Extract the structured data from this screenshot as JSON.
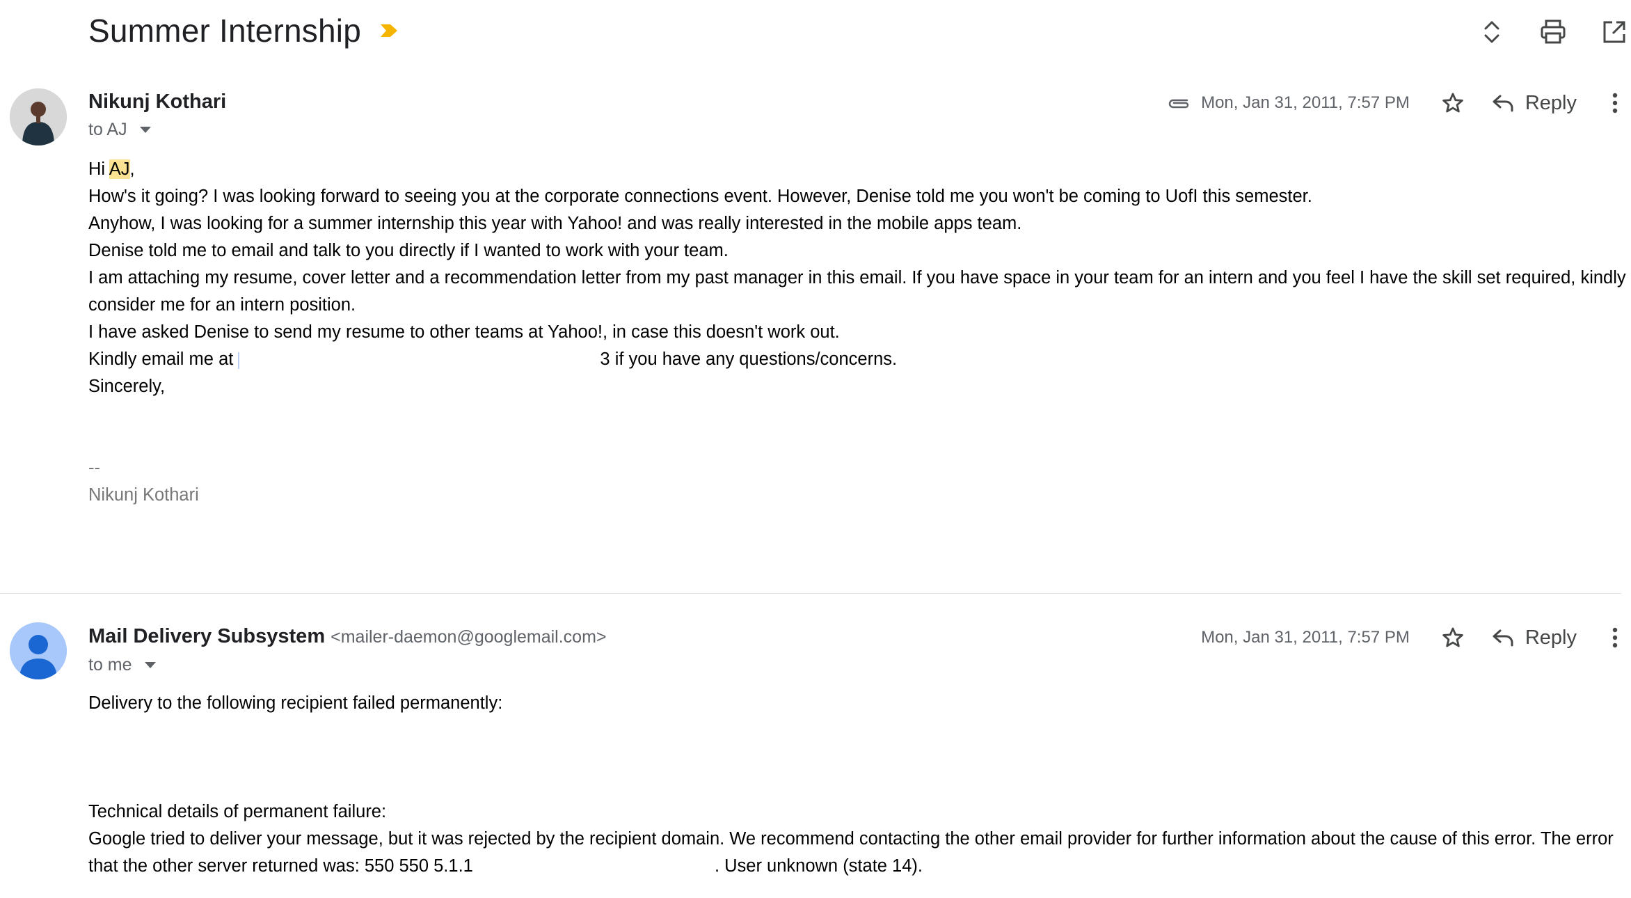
{
  "thread": {
    "subject": "Summer Internship",
    "icons": [
      "importance-marker-icon",
      "expand-collapse-icon",
      "print-icon",
      "open-new-window-icon"
    ],
    "accent_color": "#f4b400"
  },
  "messages": [
    {
      "sender_name": "Nikunj Kothari",
      "sender_email": "",
      "recipients": "to AJ",
      "date": "Mon, Jan 31, 2011, 7:57 PM",
      "reply_label": "Reply",
      "has_attachment": true,
      "body": {
        "greeting_prefix": "Hi ",
        "greeting_name": "AJ",
        "greeting_suffix": ",",
        "l1": "How's it going? I was looking forward to seeing you at the corporate connections event. However, Denise told me you won't be coming to UofI this semester.",
        "l2": "Anyhow, I was looking for a summer internship this year with Yahoo! and was really interested in the mobile apps team.",
        "l3": "Denise told me to email and talk to you directly if I wanted to work with your team.",
        "l4": "I am attaching my resume, cover letter and a recommendation letter from my past manager in this email. If you have space in your team for an intern and you feel I have the skill set required, kindly consider me for an intern position.",
        "l5": "I have asked Denise to send my resume to other teams at Yahoo!, in case this doesn't work out.",
        "l6_prefix": "Kindly email me at ",
        "l6_tail": "3",
        "l6_suffix": " if you have any questions/concerns.",
        "l7": "Sincerely,",
        "sig_dash": "--",
        "sig_name": "Nikunj Kothari"
      }
    },
    {
      "sender_name": "Mail Delivery Subsystem",
      "sender_email": "<mailer-daemon@googlemail.com>",
      "recipients": "to me",
      "date": "Mon, Jan 31, 2011, 7:57 PM",
      "reply_label": "Reply",
      "has_attachment": false,
      "body": {
        "l1": "Delivery to the following recipient failed permanently:",
        "l2": "Technical details of permanent failure:",
        "l3": "Google tried to deliver your message, but it was rejected by the recipient domain. We recommend contacting the other email provider for further information about the cause of this error. The error that the other server returned was: 550 550 5.1.1 ",
        "l3_suffix": ". User unknown (state 14)."
      }
    }
  ]
}
